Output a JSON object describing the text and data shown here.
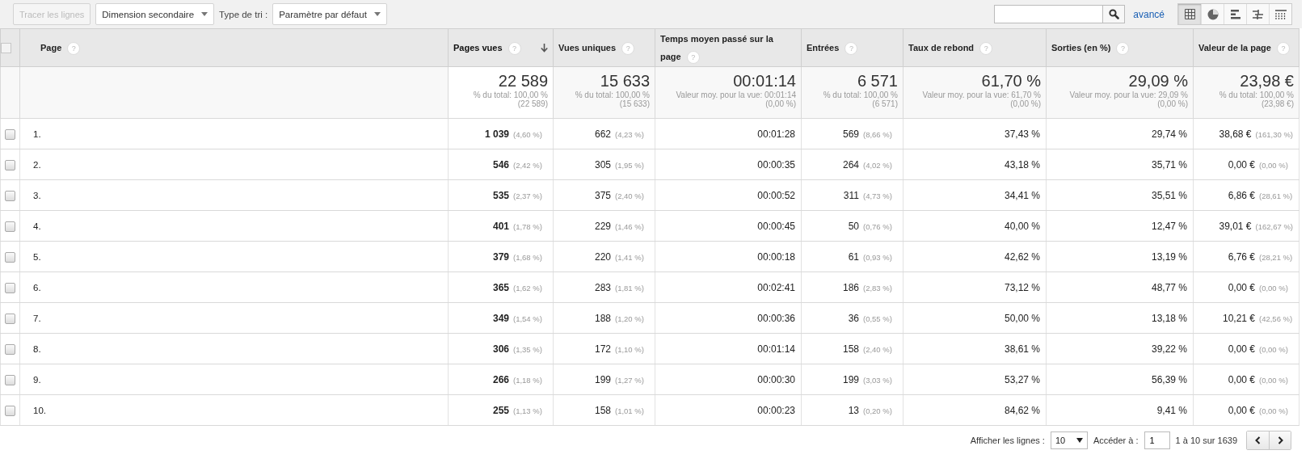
{
  "toolbar": {
    "plot_button": {
      "label": "Tracer les lignes",
      "disabled": true
    },
    "secondary_dimension": {
      "label": "Dimension secondaire"
    },
    "sort_type": {
      "label": "Type de tri :",
      "value": "Paramètre par défaut"
    },
    "advanced_link": "avancé",
    "views": [
      {
        "kind": "table",
        "selected": true
      },
      {
        "kind": "pie",
        "selected": false
      },
      {
        "kind": "bars",
        "selected": false
      },
      {
        "kind": "compare",
        "selected": false
      },
      {
        "kind": "pivot",
        "selected": false
      }
    ]
  },
  "table": {
    "select_all": {
      "checked": false
    },
    "columns": [
      {
        "label": "Page",
        "help": "?",
        "sorted": false,
        "kind": "dimension"
      },
      {
        "label": "Pages vues",
        "help": "?",
        "sorted": true,
        "kind": "metric"
      },
      {
        "label": "Vues uniques",
        "help": "?",
        "sorted": false,
        "kind": "metric"
      },
      {
        "label": "Temps moyen passé sur la page",
        "help": "?",
        "sorted": false,
        "kind": "metric"
      },
      {
        "label": "Entrées",
        "help": "?",
        "sorted": false,
        "kind": "metric"
      },
      {
        "label": "Taux de rebond",
        "help": "?",
        "sorted": false,
        "kind": "metric"
      },
      {
        "label": "Sorties (en %)",
        "help": "?",
        "sorted": false,
        "kind": "metric"
      },
      {
        "label": "Valeur de la page",
        "help": "?",
        "sorted": false,
        "kind": "metric"
      }
    ],
    "totals": [
      {
        "value": "22 589",
        "lines": [
          "% du total: 100,00 %",
          "(22 589)"
        ]
      },
      {
        "value": "15 633",
        "lines": [
          "% du total: 100,00 %",
          "(15 633)"
        ]
      },
      {
        "value": "00:01:14",
        "lines": [
          "Valeur moy. pour la vue: 00:01:14",
          "(0,00 %)"
        ]
      },
      {
        "value": "6 571",
        "lines": [
          "% du total: 100,00 %",
          "(6 571)"
        ]
      },
      {
        "value": "61,70 %",
        "lines": [
          "Valeur moy. pour la vue: 61,70 %",
          "(0,00 %)"
        ]
      },
      {
        "value": "29,09 %",
        "lines": [
          "Valeur moy. pour la vue: 29,09 %",
          "(0,00 %)"
        ]
      },
      {
        "value": "23,98 €",
        "lines": [
          "% du total: 100,00 %",
          "(23,98 €)"
        ]
      }
    ],
    "rows": [
      {
        "checked": false,
        "cells": [
          {
            "value": "1."
          },
          {
            "value": "1 039",
            "share": "(4,60 %)"
          },
          {
            "value": "662",
            "share": "(4,23 %)"
          },
          {
            "value": "00:01:28"
          },
          {
            "value": "569",
            "share": "(8,66 %)"
          },
          {
            "value": "37,43 %"
          },
          {
            "value": "29,74 %"
          },
          {
            "value": "38,68 €",
            "share": "(161,30 %)"
          }
        ]
      },
      {
        "checked": false,
        "cells": [
          {
            "value": "2."
          },
          {
            "value": "546",
            "share": "(2,42 %)"
          },
          {
            "value": "305",
            "share": "(1,95 %)"
          },
          {
            "value": "00:00:35"
          },
          {
            "value": "264",
            "share": "(4,02 %)"
          },
          {
            "value": "43,18 %"
          },
          {
            "value": "35,71 %"
          },
          {
            "value": "0,00 €",
            "share": "(0,00 %)"
          }
        ]
      },
      {
        "checked": false,
        "cells": [
          {
            "value": "3."
          },
          {
            "value": "535",
            "share": "(2,37 %)"
          },
          {
            "value": "375",
            "share": "(2,40 %)"
          },
          {
            "value": "00:00:52"
          },
          {
            "value": "311",
            "share": "(4,73 %)"
          },
          {
            "value": "34,41 %"
          },
          {
            "value": "35,51 %"
          },
          {
            "value": "6,86 €",
            "share": "(28,61 %)"
          }
        ]
      },
      {
        "checked": false,
        "cells": [
          {
            "value": "4."
          },
          {
            "value": "401",
            "share": "(1,78 %)"
          },
          {
            "value": "229",
            "share": "(1,46 %)"
          },
          {
            "value": "00:00:45"
          },
          {
            "value": "50",
            "share": "(0,76 %)"
          },
          {
            "value": "40,00 %"
          },
          {
            "value": "12,47 %"
          },
          {
            "value": "39,01 €",
            "share": "(162,67 %)"
          }
        ]
      },
      {
        "checked": false,
        "cells": [
          {
            "value": "5."
          },
          {
            "value": "379",
            "share": "(1,68 %)"
          },
          {
            "value": "220",
            "share": "(1,41 %)"
          },
          {
            "value": "00:00:18"
          },
          {
            "value": "61",
            "share": "(0,93 %)"
          },
          {
            "value": "42,62 %"
          },
          {
            "value": "13,19 %"
          },
          {
            "value": "6,76 €",
            "share": "(28,21 %)"
          }
        ]
      },
      {
        "checked": false,
        "cells": [
          {
            "value": "6."
          },
          {
            "value": "365",
            "share": "(1,62 %)"
          },
          {
            "value": "283",
            "share": "(1,81 %)"
          },
          {
            "value": "00:02:41"
          },
          {
            "value": "186",
            "share": "(2,83 %)"
          },
          {
            "value": "73,12 %"
          },
          {
            "value": "48,77 %"
          },
          {
            "value": "0,00 €",
            "share": "(0,00 %)"
          }
        ]
      },
      {
        "checked": false,
        "cells": [
          {
            "value": "7."
          },
          {
            "value": "349",
            "share": "(1,54 %)"
          },
          {
            "value": "188",
            "share": "(1,20 %)"
          },
          {
            "value": "00:00:36"
          },
          {
            "value": "36",
            "share": "(0,55 %)"
          },
          {
            "value": "50,00 %"
          },
          {
            "value": "13,18 %"
          },
          {
            "value": "10,21 €",
            "share": "(42,56 %)"
          }
        ]
      },
      {
        "checked": false,
        "cells": [
          {
            "value": "8."
          },
          {
            "value": "306",
            "share": "(1,35 %)"
          },
          {
            "value": "172",
            "share": "(1,10 %)"
          },
          {
            "value": "00:01:14"
          },
          {
            "value": "158",
            "share": "(2,40 %)"
          },
          {
            "value": "38,61 %"
          },
          {
            "value": "39,22 %"
          },
          {
            "value": "0,00 €",
            "share": "(0,00 %)"
          }
        ]
      },
      {
        "checked": false,
        "cells": [
          {
            "value": "9."
          },
          {
            "value": "266",
            "share": "(1,18 %)"
          },
          {
            "value": "199",
            "share": "(1,27 %)"
          },
          {
            "value": "00:00:30"
          },
          {
            "value": "199",
            "share": "(3,03 %)"
          },
          {
            "value": "53,27 %"
          },
          {
            "value": "56,39 %"
          },
          {
            "value": "0,00 €",
            "share": "(0,00 %)"
          }
        ]
      },
      {
        "checked": false,
        "cells": [
          {
            "value": "10."
          },
          {
            "value": "255",
            "share": "(1,13 %)"
          },
          {
            "value": "158",
            "share": "(1,01 %)"
          },
          {
            "value": "00:00:23"
          },
          {
            "value": "13",
            "share": "(0,20 %)"
          },
          {
            "value": "84,62 %"
          },
          {
            "value": "9,41 %"
          },
          {
            "value": "0,00 €",
            "share": "(0,00 %)"
          }
        ]
      }
    ]
  },
  "pagination": {
    "rows_label": "Afficher les lignes :",
    "rows_value": "10",
    "goto_label": "Accéder à :",
    "goto_value": "1",
    "range": "1 à 10 sur 1639"
  }
}
